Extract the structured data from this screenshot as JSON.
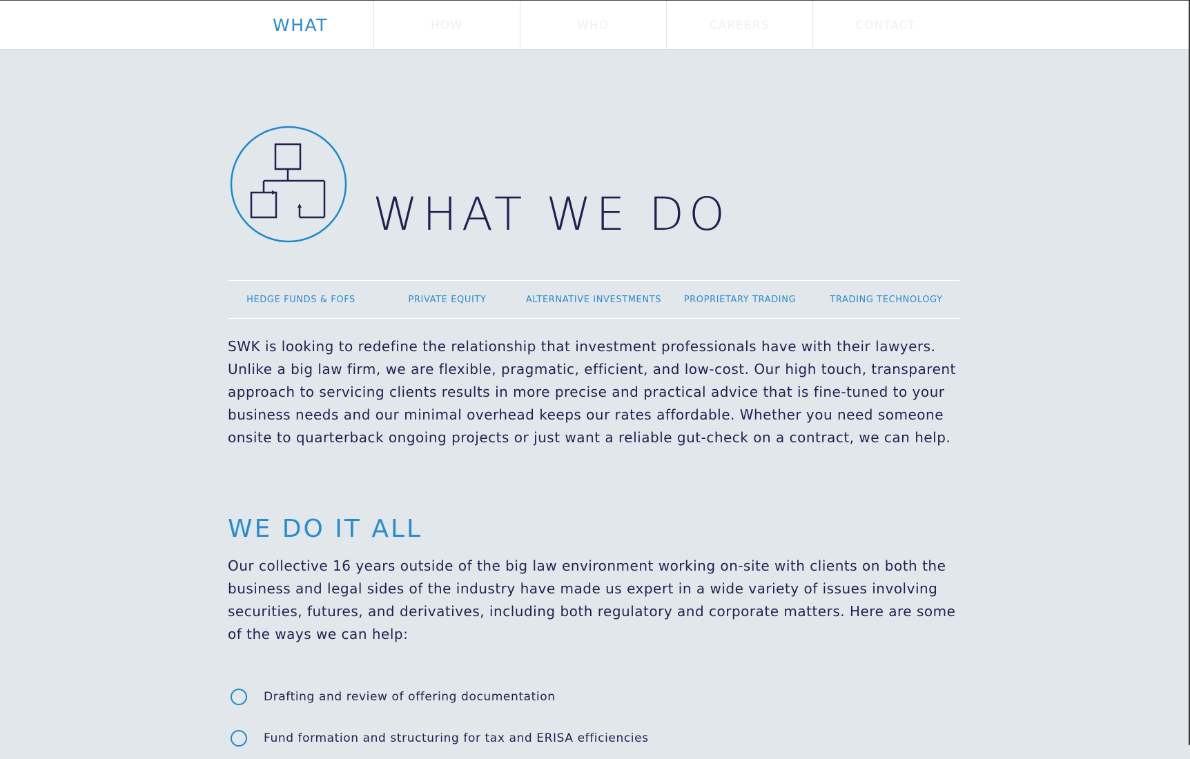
{
  "nav": {
    "items": [
      {
        "label": "WHAT",
        "active": true
      },
      {
        "label": "HOW",
        "active": false
      },
      {
        "label": "WHO",
        "active": false
      },
      {
        "label": "CAREERS",
        "active": false
      },
      {
        "label": "CONTACT",
        "active": false
      }
    ]
  },
  "hero": {
    "icon": "flowchart-icon",
    "title": "WHAT WE DO"
  },
  "subnav": {
    "items": [
      {
        "label": "HEDGE FUNDS & FOFS"
      },
      {
        "label": "PRIVATE EQUITY"
      },
      {
        "label": "ALTERNATIVE INVESTMENTS"
      },
      {
        "label": "PROPRIETARY TRADING"
      },
      {
        "label": "TRADING TECHNOLOGY"
      }
    ]
  },
  "intro": {
    "text": "SWK is looking to redefine the relationship that investment professionals have with their lawyers. Unlike a big law firm, we are flexible, pragmatic, efficient, and low-cost. Our high touch, transparent approach to servicing clients results in more precise and practical advice that is fine-tuned to your business needs and our minimal overhead keeps our rates affordable. Whether you need someone onsite to quarterback ongoing projects or just want a reliable gut-check on a contract, we can help."
  },
  "section": {
    "title": "WE DO IT ALL",
    "body": "Our collective 16 years outside of the big law environment working on-site with clients on both the business and legal sides of the industry have made us expert in a wide variety of issues involving securities, futures, and derivatives, including both regulatory and corporate matters. Here are some of the ways we can help:",
    "items": [
      {
        "text": "Drafting and review of offering documentation"
      },
      {
        "text": "Fund formation and structuring for tax and ERISA efficiencies"
      }
    ]
  },
  "colors": {
    "accent": "#2d8bc9",
    "text": "#1f2150",
    "background": "#e2e7eb",
    "nav_background": "#ffffff",
    "nav_inactive": "#eef0f2"
  }
}
